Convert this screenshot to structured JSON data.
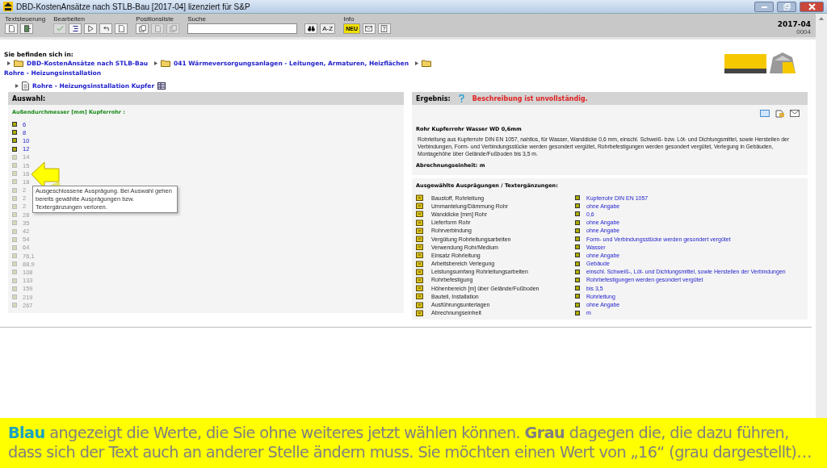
{
  "window": {
    "title": "DBD-KostenAnsätze nach STLB-Bau [2017-04] lizenziert für S&P"
  },
  "toolbar": {
    "groups": [
      {
        "label": "Textsteuerung",
        "buttons": [
          {
            "kind": "page",
            "disabled": false
          },
          {
            "kind": "exit",
            "disabled": false
          }
        ]
      },
      {
        "label": "Bearbeiten",
        "buttons": [
          {
            "kind": "check",
            "disabled": true
          },
          {
            "kind": "list",
            "disabled": false
          },
          {
            "kind": "play",
            "disabled": false
          },
          {
            "kind": "undo",
            "disabled": false
          },
          {
            "kind": "page",
            "disabled": false
          }
        ]
      },
      {
        "label": "Positionsliste",
        "buttons": [
          {
            "kind": "copy",
            "disabled": false
          },
          {
            "kind": "page",
            "disabled": true
          },
          {
            "kind": "copy",
            "disabled": true
          }
        ]
      }
    ],
    "search": {
      "label": "Suche"
    },
    "search_buttons": [
      {
        "kind": "binoculars"
      },
      {
        "kind": "text",
        "label": "A-Z"
      }
    ],
    "info": {
      "label": "Info",
      "buttons": [
        {
          "kind": "badge",
          "label": "NEU"
        },
        {
          "kind": "mail"
        },
        {
          "kind": "help"
        }
      ]
    },
    "version": "2017-04",
    "build": "0004"
  },
  "breadcrumb": {
    "heading": "Sie befinden sich in:",
    "items": [
      {
        "label": "DBD-KostenAnsätze nach STLB-Bau",
        "kind": "folder"
      },
      {
        "label": "041 Wärmeversorgungsanlagen - Leitungen, Armaturen, Heizflächen",
        "kind": "folder"
      },
      {
        "label": "Rohre - Heizungsinstallation",
        "kind": "folder"
      },
      {
        "label": "Rohre - Heizungsinstallation Kupfer",
        "kind": "doc"
      }
    ]
  },
  "selection": {
    "title": "Auswahl:",
    "attribute": "Außendurchmesser [mm] Kupferrohr :",
    "options": [
      {
        "label": "6",
        "available": true
      },
      {
        "label": "8",
        "available": true
      },
      {
        "label": "10",
        "available": true
      },
      {
        "label": "12",
        "available": true
      },
      {
        "label": "14",
        "available": false
      },
      {
        "label": "15",
        "available": false
      },
      {
        "label": "16",
        "available": false
      },
      {
        "label": "18",
        "available": false
      },
      {
        "label": "2",
        "available": false
      },
      {
        "label": "2",
        "available": false
      },
      {
        "label": "2",
        "available": false
      },
      {
        "label": "28",
        "available": false
      },
      {
        "label": "35",
        "available": false
      },
      {
        "label": "42",
        "available": false
      },
      {
        "label": "54",
        "available": false
      },
      {
        "label": "64",
        "available": false
      },
      {
        "label": "76,1",
        "available": false
      },
      {
        "label": "88,9",
        "available": false
      },
      {
        "label": "108",
        "available": false
      },
      {
        "label": "133",
        "available": false
      },
      {
        "label": "159",
        "available": false
      },
      {
        "label": "219",
        "available": false
      },
      {
        "label": "267",
        "available": false
      }
    ],
    "tooltip": "Ausgeschlossene Ausprägung. Bei Auswahl gehen bereits gewählte Ausprägungen bzw. Textergänzungen verloren."
  },
  "result": {
    "title": "Ergebnis:",
    "status": "Beschreibung ist unvollständig.",
    "heading": "Rohr Kupferrohr Wasser WD 0,6mm",
    "description": "Rohrleitung aus Kupferrohr DIN EN 1057, nahtlos, für Wasser, Wanddicke 0,6 mm, einschl. Schweiß- bzw. Löt- und Dichtungsmittel, sowie Herstellen der Verbindungen, Form- und Verbindungsstücke werden gesondert vergütet, Rohrbefestigungen werden gesondert vergütet, Verlegung in Gebäuden, Montagehöhe über Gelände/Fußboden bis 3,5 m.",
    "unit": "Abrechnungseinheit: m",
    "selected_heading": "Ausgewählte Ausprägungen / Textergänzungen:",
    "rows": [
      {
        "name": "Baustoff, Rohrleitung",
        "value": "Kupferrohr DIN EN 1057"
      },
      {
        "name": "Ummantelung/Dämmung Rohr",
        "value": "ohne Angabe"
      },
      {
        "name": "Wanddicke [mm] Rohr",
        "value": "0,6"
      },
      {
        "name": "Lieferform Rohr",
        "value": "ohne Angabe"
      },
      {
        "name": "Rohrverbindung",
        "value": "ohne Angabe"
      },
      {
        "name": "Vergütung Rohrleitungsarbeiten",
        "value": "Form- und Verbindungsstücke werden gesondert vergütet"
      },
      {
        "name": "Verwendung Rohr/Medium",
        "value": "Wasser"
      },
      {
        "name": "Einsatz Rohrleitung",
        "value": "ohne Angabe"
      },
      {
        "name": "Arbeitsbereich Verlegung",
        "value": "Gebäude"
      },
      {
        "name": "Leistungsumfang Rohrleitungsarbeiten",
        "value": "einschl. Schweiß-, Löt- und Dichtungsmittel, sowie Herstellen der Verbindungen"
      },
      {
        "name": "Rohrbefestigung",
        "value": "Rohrbefestigungen werden gesondert vergütet"
      },
      {
        "name": "Höhenbereich [m] über Gelände/Fußboden",
        "value": "bis 3,5"
      },
      {
        "name": "Bauteil, Installation",
        "value": "Rohrleitung"
      },
      {
        "name": "Ausführungsunterlagen",
        "value": "ohne Angabe"
      },
      {
        "name": "Abrechnungseinheit",
        "value": "m"
      }
    ]
  },
  "caption": "**Blau** angezeigt die Werte, die Sie ohne weiteres jetzt wählen können. **Grau** dagegen die, die dazu führen, dass sich der Text auch an anderer Stelle ändern muss. Sie möchten einen Wert von „16“ (grau dargestellt)…"
}
